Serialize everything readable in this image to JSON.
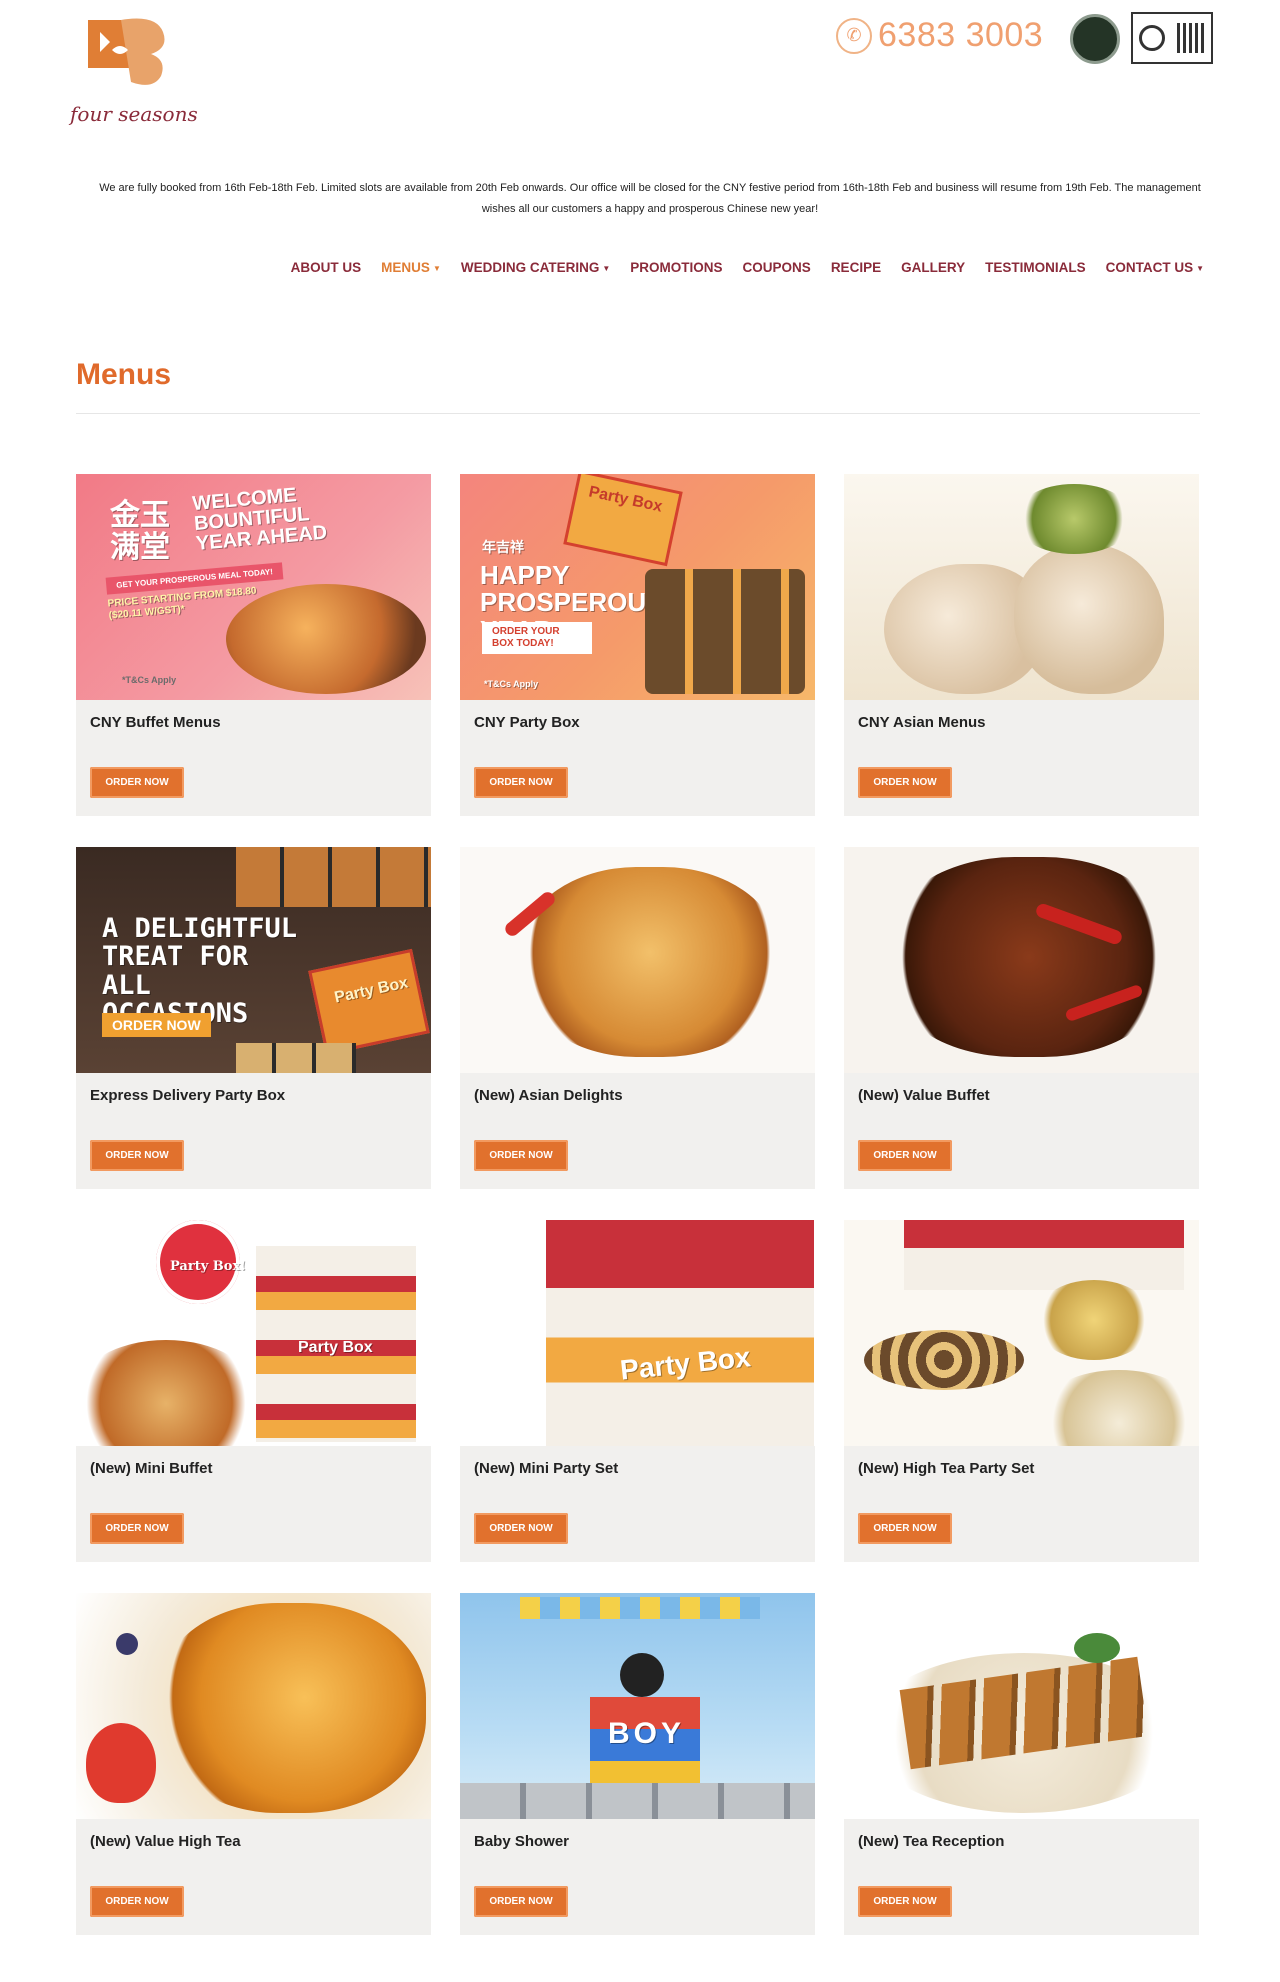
{
  "header": {
    "logo_text": "four seasons",
    "phone": "6383 3003"
  },
  "notice": "We are fully booked from 16th Feb-18th Feb. Limited slots are available from 20th Feb onwards. Our office will be closed for the CNY festive period from 16th-18th Feb and business will resume from 19th Feb. The management wishes all our customers a happy and prosperous Chinese new year!",
  "nav": [
    {
      "label": "About Us",
      "dropdown": false,
      "active": false
    },
    {
      "label": "Menus",
      "dropdown": true,
      "active": true
    },
    {
      "label": "Wedding Catering",
      "dropdown": true,
      "active": false
    },
    {
      "label": "Promotions",
      "dropdown": false,
      "active": false
    },
    {
      "label": "Coupons",
      "dropdown": false,
      "active": false
    },
    {
      "label": "Recipe",
      "dropdown": false,
      "active": false
    },
    {
      "label": "Gallery",
      "dropdown": false,
      "active": false
    },
    {
      "label": "Testimonials",
      "dropdown": false,
      "active": false
    },
    {
      "label": "Contact Us",
      "dropdown": true,
      "active": false
    }
  ],
  "page": {
    "title": "Menus"
  },
  "colors": {
    "accent": "#e1712d",
    "nav": "#8a2b3a",
    "title": "#e06a2b",
    "card_bg": "#f1f0ee"
  },
  "cards": [
    {
      "title": "CNY Buffet Menus",
      "button": "Order Now",
      "image": "cny-buffet-banner"
    },
    {
      "title": "CNY Party Box",
      "button": "Order Now",
      "image": "cny-party-box-banner"
    },
    {
      "title": "CNY Asian Menus",
      "button": "Order Now",
      "image": "steamed-fish-photo"
    },
    {
      "title": "Express Delivery Party Box",
      "button": "Order Now",
      "image": "party-box-banner"
    },
    {
      "title": "(New) Asian Delights",
      "button": "Order Now",
      "image": "fried-fish-photo"
    },
    {
      "title": "(New) Value Buffet",
      "button": "Order Now",
      "image": "chilli-chicken-photo"
    },
    {
      "title": "(New) Mini Buffet",
      "button": "Order Now",
      "image": "mini-buffet-boxes-photo"
    },
    {
      "title": "(New) Mini Party Set",
      "button": "Order Now",
      "image": "party-box-photo"
    },
    {
      "title": "(New) High Tea Party Set",
      "button": "Order Now",
      "image": "high-tea-photo"
    },
    {
      "title": "(New) Value High Tea",
      "button": "Order Now",
      "image": "fried-snacks-photo"
    },
    {
      "title": "Baby Shower",
      "button": "Order Now",
      "image": "baby-shower-photo"
    },
    {
      "title": "(New) Tea Reception",
      "button": "Order Now",
      "image": "spring-rolls-photo"
    }
  ],
  "banners": {
    "cny_buffet": {
      "headline": "WELCOME BOUNTIFUL YEAR AHEAD",
      "chinese": "金玉 满堂",
      "cta": "GET YOUR PROSPEROUS MEAL TODAY!",
      "price": "PRICE STARTING FROM $18.80 ($20.11 W/GST)*",
      "terms": "*T&Cs Apply"
    },
    "cny_party_box": {
      "headline": "HAPPY PROSPEROUS YEAR",
      "chinese": "年吉祥",
      "cta": "ORDER YOUR BOX TODAY!",
      "terms": "*T&Cs Apply",
      "box": "Party Box"
    },
    "party_box": {
      "headline": "A DELIGHTFUL TREAT FOR ALL OCCASIONS",
      "cta": "ORDER NOW",
      "box": "Party Box"
    },
    "mini_buffet": {
      "sticker": "Party Box!",
      "box": "Party Box"
    },
    "mini_party_set": {
      "box": "Party Box"
    },
    "baby_shower": {
      "letters": "BOY"
    }
  }
}
